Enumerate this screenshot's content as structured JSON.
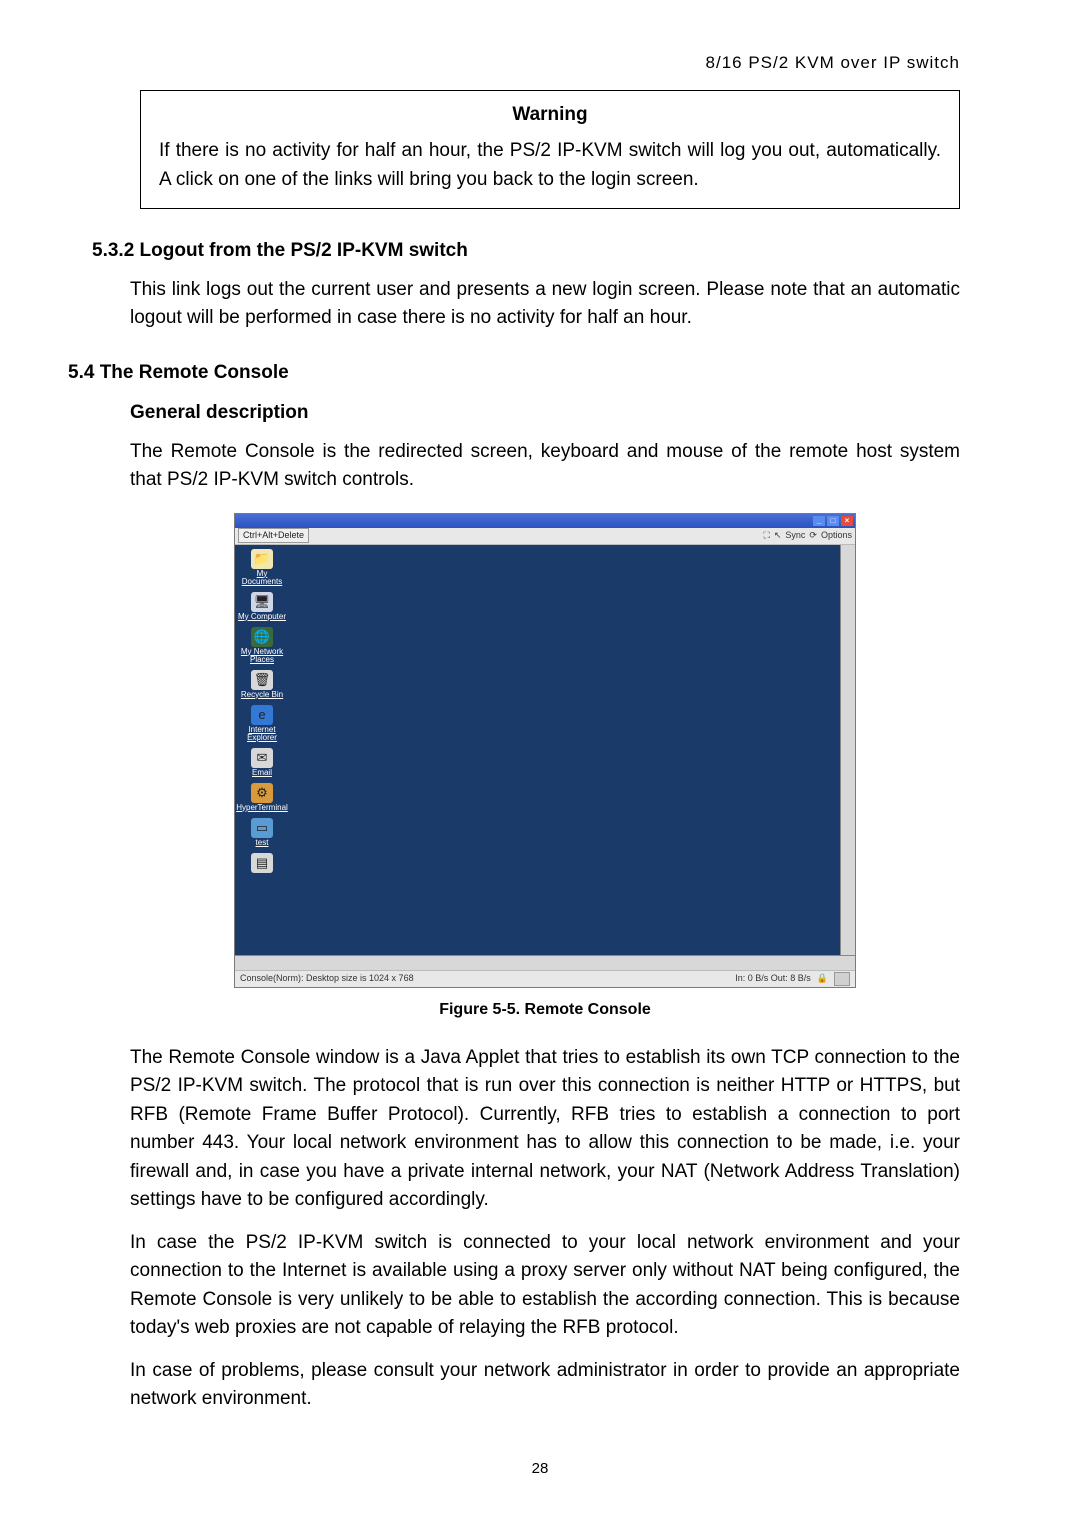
{
  "header": {
    "right": "8/16 PS/2 KVM over IP switch"
  },
  "warning": {
    "title": "Warning",
    "text": "If there is no activity for half an hour, the PS/2 IP-KVM switch will log you out, automatically. A click on one of the links will bring you back to the login screen."
  },
  "s532": {
    "heading": "5.3.2  Logout from the PS/2 IP-KVM switch",
    "para": "This link logs out the current user and presents a new login screen. Please note that an automatic logout will be performed in case there is no activity for half an hour."
  },
  "s54": {
    "heading": "5.4 The Remote Console",
    "subheading": "General description",
    "intro": "The Remote Console is the redirected screen, keyboard and mouse of the remote host system that PS/2 IP-KVM switch controls."
  },
  "figure": {
    "caption": "Figure 5-5. Remote Console",
    "toolbar": {
      "cad": "Ctrl+Alt+Delete",
      "sync": "Sync",
      "options": "Options"
    },
    "icons": [
      {
        "glyph": "📁",
        "label": "My Documents",
        "bg": "#f2e7b0"
      },
      {
        "glyph": "🖥",
        "label": "My Computer",
        "bg": "#cfd7e6"
      },
      {
        "glyph": "🌐",
        "label": "My Network Places",
        "bg": "#3a6a3a"
      },
      {
        "glyph": "🗑",
        "label": "Recycle Bin",
        "bg": "#d8d8d8"
      },
      {
        "glyph": "e",
        "label": "Internet Explorer",
        "bg": "#3478d6"
      },
      {
        "glyph": "✉",
        "label": "Email",
        "bg": "#d8d8d8"
      },
      {
        "glyph": "⚙",
        "label": "HyperTerminal",
        "bg": "#d89a3a"
      },
      {
        "glyph": "▭",
        "label": "test",
        "bg": "#5a9bd4"
      },
      {
        "glyph": "▤",
        "label": "",
        "bg": "#d8d8d8"
      }
    ],
    "status": {
      "left": "Console(Norm): Desktop size is 1024 x 768",
      "right": "In: 0 B/s Out: 8 B/s"
    }
  },
  "after": {
    "p1": "The Remote Console window is a Java Applet that tries to establish its own TCP connection to the PS/2 IP-KVM switch. The protocol that is run over this connection is neither HTTP or HTTPS, but RFB (Remote Frame Buffer Protocol). Currently, RFB tries to establish a connection to port number 443. Your local network environment has to allow this connection to be made, i.e. your firewall and, in case you have a private internal network, your NAT (Network Address Translation) settings have to be configured accordingly.",
    "p2": "In case the PS/2 IP-KVM switch is connected to your local network environment and your connection to the Internet is available using a proxy server only without NAT being configured, the Remote Console is very unlikely to be able to establish the according connection. This is because today's web proxies are not capable of relaying the RFB protocol.",
    "p3": "In case of problems, please consult your network administrator in order to provide an appropriate network environment."
  },
  "page": "28"
}
